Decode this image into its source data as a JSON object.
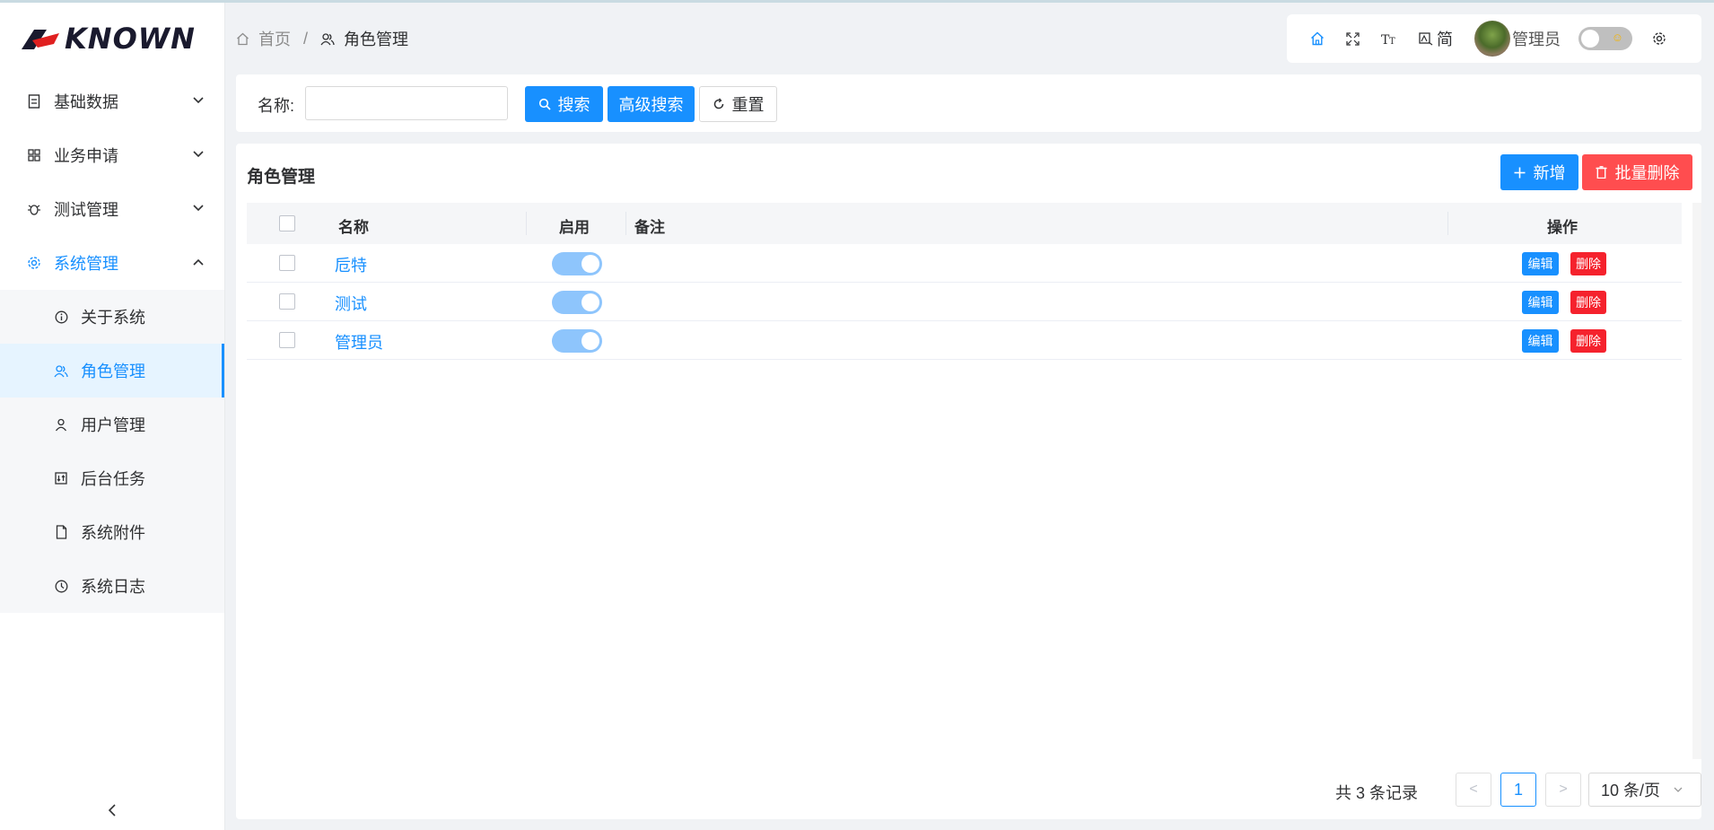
{
  "app": {
    "logo_text": "KNOWN"
  },
  "sidebar": {
    "items": [
      {
        "label": "基础数据",
        "icon": "document-icon"
      },
      {
        "label": "业务申请",
        "icon": "grid-icon"
      },
      {
        "label": "测试管理",
        "icon": "bug-icon"
      },
      {
        "label": "系统管理",
        "icon": "gear-icon"
      }
    ],
    "subitems": [
      {
        "label": "关于系统",
        "icon": "info-icon"
      },
      {
        "label": "角色管理",
        "icon": "users-icon"
      },
      {
        "label": "用户管理",
        "icon": "user-icon"
      },
      {
        "label": "后台任务",
        "icon": "task-icon"
      },
      {
        "label": "系统附件",
        "icon": "file-icon"
      },
      {
        "label": "系统日志",
        "icon": "clock-icon"
      }
    ]
  },
  "breadcrumb": {
    "home": "首页",
    "separator": "/",
    "current": "角色管理"
  },
  "toolbar": {
    "lang_label": "简",
    "user_name": "管理员"
  },
  "search": {
    "name_label": "名称:",
    "name_value": "",
    "search_label": "搜索",
    "advanced_label": "高级搜索",
    "reset_label": "重置"
  },
  "main": {
    "title": "角色管理",
    "add_label": "新增",
    "batch_delete_label": "批量删除",
    "columns": [
      "名称",
      "启用",
      "备注",
      "操作"
    ],
    "rows": [
      {
        "name": "卮特",
        "enabled": true,
        "remark": ""
      },
      {
        "name": "测试",
        "enabled": true,
        "remark": ""
      },
      {
        "name": "管理员",
        "enabled": true,
        "remark": ""
      }
    ],
    "edit_label": "编辑",
    "delete_label": "删除"
  },
  "pagination": {
    "total_text": "共 3 条记录",
    "current_page": "1",
    "prev": "<",
    "next": ">",
    "page_size": "10 条/页"
  },
  "colors": {
    "primary": "#1890ff",
    "danger": "#ff4d4f",
    "switch_on": "#8ec5fc"
  }
}
